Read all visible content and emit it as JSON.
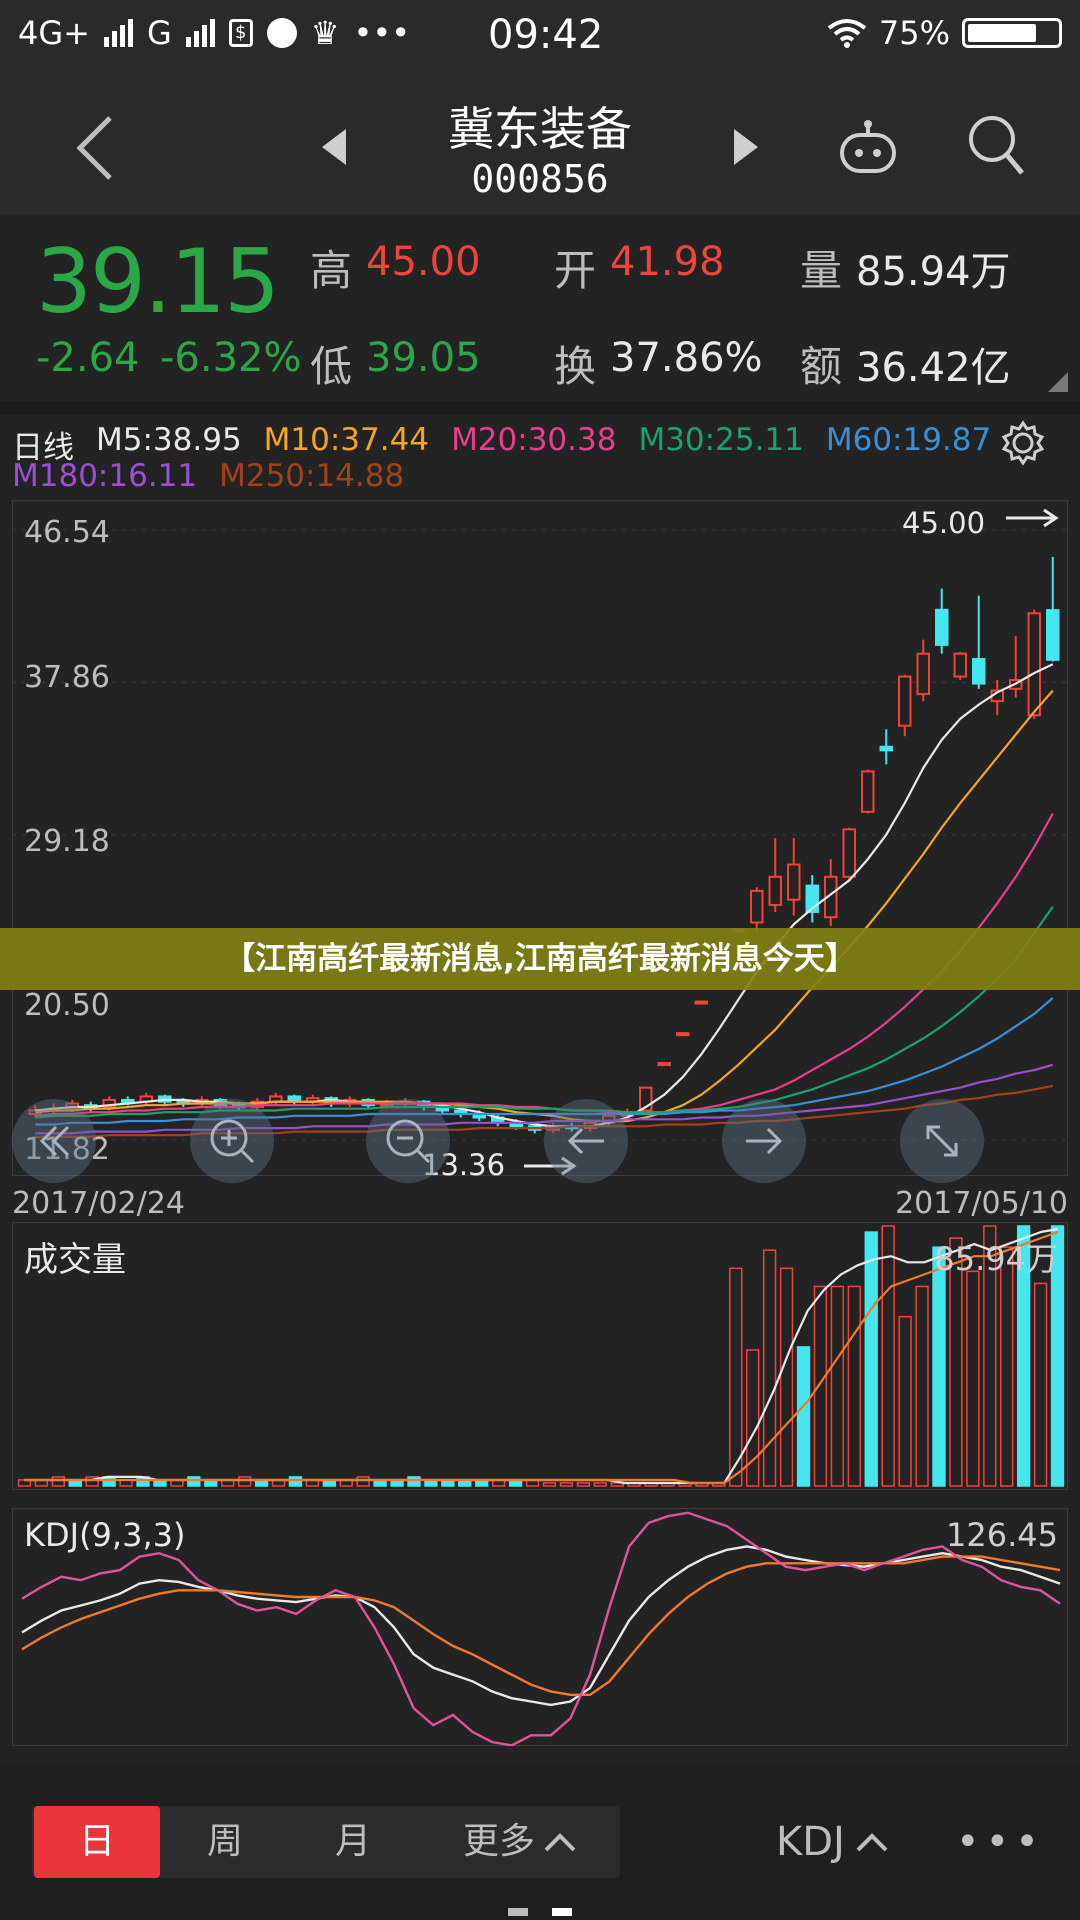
{
  "status": {
    "network1": "4G+",
    "network2": "G",
    "time": "09:42",
    "battery": "75%",
    "icons": [
      "sim-icon",
      "paint-icon",
      "crown-icon",
      "more-icon",
      "wifi-icon",
      "battery-icon"
    ]
  },
  "header": {
    "name": "冀东装备",
    "code": "000856"
  },
  "quote": {
    "price": "39.15",
    "change": "-2.64",
    "change_pct": "-6.32%",
    "high_label": "高",
    "high": "45.00",
    "low_label": "低",
    "low": "39.05",
    "open_label": "开",
    "open": "41.98",
    "turnover_label": "换",
    "turnover": "37.86%",
    "volume_label": "量",
    "volume": "85.94万",
    "amount_label": "额",
    "amount": "36.42亿"
  },
  "ma": {
    "label": "日线",
    "items": [
      {
        "text": "M5:38.95",
        "color": "#e9e9e9"
      },
      {
        "text": "M10:37.44",
        "color": "#f5a623"
      },
      {
        "text": "M20:30.38",
        "color": "#e83e8c"
      },
      {
        "text": "M30:25.11",
        "color": "#1aa36b"
      },
      {
        "text": "M60:19.87",
        "color": "#3a8fd9"
      },
      {
        "text": "M180:16.11",
        "color": "#9b4fd1"
      },
      {
        "text": "M250:14.88",
        "color": "#a0421a"
      }
    ]
  },
  "kline": {
    "y_ticks": [
      "46.54",
      "37.86",
      "29.18",
      "20.50",
      "11.82"
    ],
    "max_label": "45.00",
    "min_label": "13.36",
    "date_start": "2017/02/24",
    "date_end": "2017/05/10"
  },
  "banner": "【江南高纤最新消息,江南高纤最新消息今天】",
  "volume": {
    "label": "成交量",
    "max_label": "85.94万"
  },
  "kdj": {
    "label": "KDJ(9,3,3)",
    "max_label": "126.45"
  },
  "bottom": {
    "tabs": [
      "日",
      "周",
      "月",
      "更多"
    ],
    "indicator": "KDJ",
    "more": "•••"
  },
  "chart_data": {
    "type": "candlestick",
    "date_range": [
      "2017/02/24",
      "2017/05/10"
    ],
    "ylim": [
      11.82,
      46.54
    ],
    "y_ticks": [
      46.54,
      37.86,
      29.18,
      20.5,
      11.82
    ],
    "candles": [
      {
        "o": 13.3,
        "c": 13.5,
        "h": 13.8,
        "l": 13.1
      },
      {
        "o": 13.5,
        "c": 13.6,
        "h": 13.9,
        "l": 13.3
      },
      {
        "o": 13.6,
        "c": 13.9,
        "h": 14.1,
        "l": 13.4
      },
      {
        "o": 13.8,
        "c": 13.6,
        "h": 14.0,
        "l": 13.4
      },
      {
        "o": 13.7,
        "c": 14.1,
        "h": 14.3,
        "l": 13.5
      },
      {
        "o": 14.1,
        "c": 14.0,
        "h": 14.3,
        "l": 13.8
      },
      {
        "o": 14.0,
        "c": 14.3,
        "h": 14.5,
        "l": 13.8
      },
      {
        "o": 14.3,
        "c": 14.0,
        "h": 14.4,
        "l": 13.8
      },
      {
        "o": 14.0,
        "c": 13.9,
        "h": 14.2,
        "l": 13.7
      },
      {
        "o": 13.9,
        "c": 14.1,
        "h": 14.3,
        "l": 13.7
      },
      {
        "o": 14.1,
        "c": 13.8,
        "h": 14.2,
        "l": 13.6
      },
      {
        "o": 13.8,
        "c": 13.7,
        "h": 14.0,
        "l": 13.5
      },
      {
        "o": 13.7,
        "c": 14.0,
        "h": 14.2,
        "l": 13.5
      },
      {
        "o": 14.0,
        "c": 14.3,
        "h": 14.5,
        "l": 13.8
      },
      {
        "o": 14.3,
        "c": 14.0,
        "h": 14.4,
        "l": 13.8
      },
      {
        "o": 14.0,
        "c": 14.2,
        "h": 14.4,
        "l": 13.8
      },
      {
        "o": 14.2,
        "c": 13.9,
        "h": 14.3,
        "l": 13.7
      },
      {
        "o": 13.9,
        "c": 14.1,
        "h": 14.3,
        "l": 13.7
      },
      {
        "o": 14.1,
        "c": 13.8,
        "h": 14.2,
        "l": 13.6
      },
      {
        "o": 13.8,
        "c": 13.9,
        "h": 14.1,
        "l": 13.6
      },
      {
        "o": 13.9,
        "c": 14.0,
        "h": 14.2,
        "l": 13.7
      },
      {
        "o": 14.0,
        "c": 13.7,
        "h": 14.1,
        "l": 13.5
      },
      {
        "o": 13.7,
        "c": 13.5,
        "h": 13.9,
        "l": 13.3
      },
      {
        "o": 13.5,
        "c": 13.3,
        "h": 13.7,
        "l": 13.1
      },
      {
        "o": 13.3,
        "c": 13.1,
        "h": 13.5,
        "l": 12.9
      },
      {
        "o": 13.1,
        "c": 12.8,
        "h": 13.3,
        "l": 12.6
      },
      {
        "o": 12.8,
        "c": 12.6,
        "h": 13.0,
        "l": 12.4
      },
      {
        "o": 12.6,
        "c": 12.4,
        "h": 12.8,
        "l": 12.2
      },
      {
        "o": 12.4,
        "c": 12.6,
        "h": 12.8,
        "l": 12.2
      },
      {
        "o": 12.6,
        "c": 12.5,
        "h": 12.8,
        "l": 12.3
      },
      {
        "o": 12.5,
        "c": 12.8,
        "h": 13.0,
        "l": 12.3
      },
      {
        "o": 12.8,
        "c": 13.2,
        "h": 13.4,
        "l": 12.6
      },
      {
        "o": 13.2,
        "c": 13.4,
        "h": 13.6,
        "l": 13.0
      },
      {
        "o": 13.5,
        "c": 14.8,
        "h": 14.8,
        "l": 13.5
      },
      {
        "o": 16.2,
        "c": 16.2,
        "h": 16.2,
        "l": 16.2
      },
      {
        "o": 17.9,
        "c": 17.9,
        "h": 17.9,
        "l": 17.9
      },
      {
        "o": 19.7,
        "c": 19.7,
        "h": 19.7,
        "l": 19.7
      },
      {
        "o": 21.6,
        "c": 21.7,
        "h": 21.7,
        "l": 21.6
      },
      {
        "o": 23.8,
        "c": 23.8,
        "h": 23.8,
        "l": 23.8
      },
      {
        "o": 24.2,
        "c": 26.0,
        "h": 26.2,
        "l": 23.6
      },
      {
        "o": 25.2,
        "c": 26.8,
        "h": 29.0,
        "l": 24.8
      },
      {
        "o": 25.5,
        "c": 27.5,
        "h": 29.0,
        "l": 24.6
      },
      {
        "o": 26.3,
        "c": 24.8,
        "h": 26.9,
        "l": 24.2
      },
      {
        "o": 24.5,
        "c": 26.8,
        "h": 27.8,
        "l": 24.0
      },
      {
        "o": 26.8,
        "c": 29.5,
        "h": 29.6,
        "l": 26.5
      },
      {
        "o": 30.5,
        "c": 32.8,
        "h": 32.9,
        "l": 30.4
      },
      {
        "o": 34.2,
        "c": 34.0,
        "h": 35.2,
        "l": 33.2
      },
      {
        "o": 35.4,
        "c": 38.2,
        "h": 38.3,
        "l": 34.8
      },
      {
        "o": 37.2,
        "c": 39.5,
        "h": 40.3,
        "l": 36.8
      },
      {
        "o": 42.0,
        "c": 40.0,
        "h": 43.2,
        "l": 39.5
      },
      {
        "o": 38.2,
        "c": 39.5,
        "h": 39.6,
        "l": 38.0
      },
      {
        "o": 39.2,
        "c": 37.8,
        "h": 42.8,
        "l": 37.5
      },
      {
        "o": 36.8,
        "c": 37.4,
        "h": 38.0,
        "l": 36.0
      },
      {
        "o": 37.5,
        "c": 38.0,
        "h": 40.5,
        "l": 37.0
      },
      {
        "o": 36.0,
        "c": 41.8,
        "h": 42.0,
        "l": 35.8
      },
      {
        "o": 41.98,
        "c": 39.15,
        "h": 45.0,
        "l": 39.05
      }
    ],
    "ma_series": [
      {
        "name": "M5",
        "color": "#e9e9e9",
        "values": [
          13.5,
          13.6,
          13.7,
          13.7,
          13.8,
          13.9,
          14.0,
          14.1,
          14.1,
          14.0,
          14.0,
          13.9,
          13.9,
          14.0,
          14.0,
          14.0,
          14.1,
          14.0,
          14.0,
          13.9,
          13.9,
          13.9,
          13.8,
          13.6,
          13.4,
          13.1,
          12.9,
          12.7,
          12.6,
          12.6,
          12.6,
          12.8,
          13.1,
          13.7,
          14.4,
          15.4,
          16.7,
          18.2,
          19.8,
          21.4,
          22.8,
          24.1,
          25.0,
          25.8,
          26.6,
          27.8,
          29.2,
          31.0,
          33.0,
          34.6,
          35.8,
          36.6,
          37.3,
          37.8,
          38.4,
          38.9
        ]
      },
      {
        "name": "M10",
        "color": "#f5a623",
        "values": [
          13.4,
          13.5,
          13.5,
          13.6,
          13.6,
          13.7,
          13.8,
          13.8,
          13.9,
          13.9,
          13.9,
          13.9,
          13.9,
          14.0,
          14.0,
          14.0,
          14.0,
          14.0,
          14.0,
          14.0,
          14.0,
          13.9,
          13.9,
          13.8,
          13.7,
          13.6,
          13.4,
          13.3,
          13.2,
          13.0,
          12.9,
          12.9,
          12.9,
          13.1,
          13.4,
          13.8,
          14.4,
          15.2,
          16.1,
          17.1,
          18.1,
          19.3,
          20.5,
          21.6,
          22.8,
          24.0,
          25.3,
          26.7,
          28.1,
          29.6,
          31.0,
          32.3,
          33.6,
          34.9,
          36.2,
          37.4
        ]
      },
      {
        "name": "M20",
        "color": "#e83e8c",
        "values": [
          13.2,
          13.3,
          13.3,
          13.4,
          13.4,
          13.5,
          13.5,
          13.6,
          13.6,
          13.7,
          13.7,
          13.7,
          13.8,
          13.8,
          13.8,
          13.8,
          13.9,
          13.9,
          13.9,
          13.9,
          13.9,
          13.9,
          13.9,
          13.9,
          13.8,
          13.8,
          13.7,
          13.7,
          13.6,
          13.5,
          13.5,
          13.4,
          13.4,
          13.4,
          13.4,
          13.5,
          13.6,
          13.8,
          14.1,
          14.4,
          14.7,
          15.2,
          15.8,
          16.4,
          17.0,
          17.7,
          18.5,
          19.4,
          20.4,
          21.4,
          22.6,
          23.9,
          25.3,
          26.8,
          28.5,
          30.4
        ]
      },
      {
        "name": "M30",
        "color": "#1aa36b",
        "values": [
          13.1,
          13.2,
          13.2,
          13.2,
          13.3,
          13.3,
          13.3,
          13.4,
          13.4,
          13.4,
          13.5,
          13.5,
          13.5,
          13.5,
          13.6,
          13.6,
          13.6,
          13.6,
          13.6,
          13.7,
          13.7,
          13.7,
          13.7,
          13.7,
          13.7,
          13.7,
          13.6,
          13.6,
          13.6,
          13.5,
          13.5,
          13.5,
          13.4,
          13.4,
          13.4,
          13.5,
          13.5,
          13.6,
          13.7,
          13.9,
          14.1,
          14.4,
          14.7,
          15.1,
          15.5,
          15.9,
          16.4,
          17.0,
          17.6,
          18.3,
          19.1,
          20.0,
          21.0,
          22.1,
          23.6,
          25.1
        ]
      },
      {
        "name": "M60",
        "color": "#3a8fd9",
        "values": [
          12.7,
          12.7,
          12.8,
          12.8,
          12.8,
          12.9,
          12.9,
          12.9,
          13.0,
          13.0,
          13.0,
          13.1,
          13.1,
          13.1,
          13.2,
          13.2,
          13.2,
          13.2,
          13.3,
          13.3,
          13.3,
          13.3,
          13.3,
          13.3,
          13.3,
          13.3,
          13.3,
          13.3,
          13.3,
          13.3,
          13.3,
          13.3,
          13.3,
          13.3,
          13.3,
          13.4,
          13.4,
          13.5,
          13.5,
          13.6,
          13.7,
          13.8,
          14.0,
          14.2,
          14.4,
          14.6,
          14.9,
          15.2,
          15.6,
          16.0,
          16.5,
          17.0,
          17.6,
          18.3,
          19.0,
          19.9
        ]
      },
      {
        "name": "M180",
        "color": "#9b4fd1",
        "values": [
          12.2,
          12.2,
          12.2,
          12.3,
          12.3,
          12.3,
          12.3,
          12.4,
          12.4,
          12.4,
          12.4,
          12.5,
          12.5,
          12.5,
          12.5,
          12.6,
          12.6,
          12.6,
          12.6,
          12.7,
          12.7,
          12.7,
          12.7,
          12.8,
          12.8,
          12.8,
          12.8,
          12.8,
          12.9,
          12.9,
          12.9,
          12.9,
          13.0,
          13.0,
          13.0,
          13.0,
          13.1,
          13.1,
          13.2,
          13.2,
          13.3,
          13.4,
          13.5,
          13.6,
          13.7,
          13.8,
          14.0,
          14.2,
          14.4,
          14.6,
          14.8,
          15.1,
          15.3,
          15.6,
          15.8,
          16.1
        ]
      },
      {
        "name": "M250",
        "color": "#a0421a",
        "values": [
          12.0,
          12.0,
          12.0,
          12.0,
          12.1,
          12.1,
          12.1,
          12.1,
          12.1,
          12.2,
          12.2,
          12.2,
          12.2,
          12.2,
          12.3,
          12.3,
          12.3,
          12.3,
          12.3,
          12.4,
          12.4,
          12.4,
          12.4,
          12.4,
          12.5,
          12.5,
          12.5,
          12.5,
          12.5,
          12.6,
          12.6,
          12.6,
          12.6,
          12.6,
          12.7,
          12.7,
          12.7,
          12.8,
          12.8,
          12.9,
          12.9,
          13.0,
          13.1,
          13.2,
          13.3,
          13.4,
          13.5,
          13.6,
          13.8,
          13.9,
          14.1,
          14.2,
          14.4,
          14.5,
          14.7,
          14.9
        ]
      }
    ],
    "volume": {
      "ymax": 86,
      "values": [
        2,
        2,
        3,
        2,
        3,
        3,
        2,
        3,
        2,
        2,
        3,
        2,
        2,
        3,
        2,
        2,
        3,
        2,
        2,
        2,
        3,
        2,
        2,
        3,
        2,
        2,
        2,
        2,
        2,
        2,
        2,
        1,
        1,
        1,
        1,
        1,
        1,
        1,
        1,
        1,
        1,
        1,
        72,
        45,
        78,
        72,
        46,
        66,
        66,
        66,
        84,
        86,
        56,
        66,
        79,
        82,
        71,
        86,
        79,
        86,
        67,
        86
      ],
      "up": [
        1,
        1,
        1,
        0,
        1,
        0,
        1,
        0,
        0,
        1,
        0,
        0,
        1,
        1,
        0,
        1,
        0,
        1,
        0,
        1,
        1,
        0,
        0,
        0,
        0,
        0,
        0,
        0,
        1,
        0,
        1,
        1,
        1,
        1,
        1,
        1,
        1,
        1,
        1,
        1,
        1,
        1,
        1,
        1,
        1,
        1,
        0,
        1,
        1,
        1,
        0,
        1,
        1,
        1,
        0,
        1,
        1,
        1,
        1,
        0,
        1,
        0
      ],
      "ma5": [
        2,
        2,
        2,
        2,
        2,
        3,
        3,
        3,
        2,
        2,
        2,
        2,
        2,
        2,
        2,
        2,
        2,
        2,
        2,
        2,
        2,
        2,
        2,
        2,
        2,
        2,
        2,
        2,
        2,
        2,
        2,
        2,
        2,
        2,
        2,
        2,
        1,
        1,
        1,
        1,
        1,
        1,
        1,
        10,
        20,
        32,
        46,
        58,
        65,
        70,
        73,
        75,
        76,
        74,
        74,
        76,
        78,
        80,
        78,
        80,
        82,
        84,
        85
      ],
      "ma10": [
        2,
        2,
        2,
        2,
        2,
        2,
        2,
        2,
        2,
        2,
        2,
        2,
        2,
        2,
        2,
        2,
        2,
        2,
        2,
        2,
        2,
        2,
        2,
        2,
        2,
        2,
        2,
        2,
        2,
        2,
        2,
        2,
        2,
        2,
        2,
        2,
        2,
        2,
        2,
        2,
        1,
        1,
        1,
        5,
        10,
        16,
        22,
        28,
        36,
        44,
        52,
        60,
        66,
        68,
        70,
        72,
        74,
        76,
        76,
        78,
        80,
        82,
        84
      ]
    },
    "kdj": {
      "ylim": [
        -10,
        126.45
      ],
      "K": [
        55,
        62,
        68,
        71,
        74,
        78,
        84,
        86,
        85,
        82,
        80,
        77,
        75,
        74,
        73,
        75,
        77,
        76,
        70,
        58,
        42,
        34,
        30,
        26,
        20,
        16,
        14,
        12,
        14,
        22,
        42,
        62,
        76,
        86,
        94,
        100,
        104,
        106,
        104,
        100,
        98,
        96,
        95,
        94,
        96,
        98,
        100,
        102,
        100,
        98,
        94,
        92,
        88,
        84
      ],
      "D": [
        45,
        52,
        58,
        63,
        67,
        71,
        75,
        78,
        80,
        80,
        80,
        79,
        78,
        77,
        76,
        76,
        76,
        76,
        74,
        70,
        62,
        54,
        47,
        42,
        36,
        30,
        24,
        20,
        18,
        18,
        26,
        40,
        54,
        66,
        76,
        84,
        90,
        94,
        96,
        96,
        96,
        96,
        96,
        96,
        96,
        96,
        98,
        100,
        100,
        100,
        98,
        96,
        94,
        92
      ],
      "J": [
        75,
        82,
        88,
        86,
        90,
        92,
        100,
        102,
        98,
        86,
        80,
        72,
        68,
        70,
        66,
        74,
        80,
        76,
        58,
        36,
        10,
        0,
        6,
        -4,
        -10,
        -12,
        -6,
        -6,
        4,
        30,
        70,
        106,
        120,
        124,
        126,
        122,
        118,
        110,
        102,
        94,
        92,
        94,
        96,
        92,
        96,
        100,
        104,
        106,
        98,
        94,
        86,
        82,
        80,
        72
      ]
    }
  }
}
